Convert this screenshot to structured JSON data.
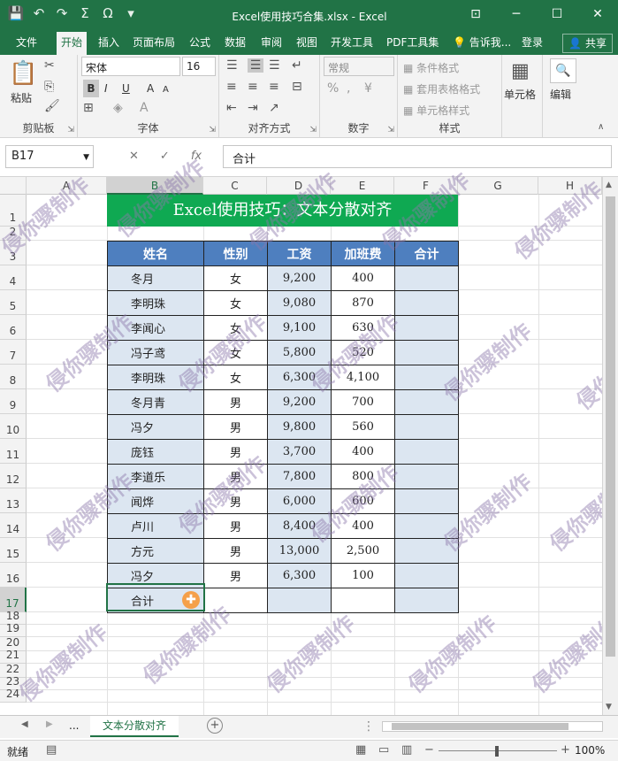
{
  "window": {
    "title": "Excel使用技巧合集.xlsx - Excel"
  },
  "tabs": [
    "文件",
    "开始",
    "插入",
    "页面布局",
    "公式",
    "数据",
    "审阅",
    "视图",
    "开发工具",
    "PDF工具集"
  ],
  "tell_me": "告诉我...",
  "login": "登录",
  "share": "共享",
  "ribbon": {
    "clipboard": {
      "label": "剪贴板",
      "paste": "粘贴"
    },
    "font": {
      "label": "字体",
      "name": "宋体",
      "size": "16",
      "bold": "B",
      "italic": "I",
      "underline": "U",
      "grow": "A",
      "shrink": "A"
    },
    "align": {
      "label": "对齐方式"
    },
    "number": {
      "label": "数字",
      "format": "常规"
    },
    "styles": {
      "label": "样式",
      "cond": "条件格式",
      "table": "套用表格格式",
      "cell": "单元格样式"
    },
    "cells": {
      "label": "单元格"
    },
    "editing": {
      "label": "编辑"
    }
  },
  "formula_bar": {
    "name_box": "B17",
    "fx": "fx",
    "value": "合计",
    "cancel": "✕",
    "enter": "✓"
  },
  "columns": [
    "A",
    "B",
    "C",
    "D",
    "E",
    "F",
    "G",
    "H"
  ],
  "rows": [
    "1",
    "2",
    "3",
    "4",
    "5",
    "6",
    "7",
    "8",
    "9",
    "10",
    "11",
    "12",
    "13",
    "14",
    "15",
    "16",
    "17",
    "18",
    "19",
    "20",
    "21",
    "22",
    "23",
    "24"
  ],
  "sheet": {
    "banner": "Excel使用技巧：文本分散对齐",
    "headers": [
      "姓名",
      "性别",
      "工资",
      "加班费",
      "合计"
    ],
    "records": [
      [
        "冬月",
        "女",
        "9,200",
        "400",
        ""
      ],
      [
        "李明珠",
        "女",
        "9,080",
        "870",
        ""
      ],
      [
        "李闻心",
        "女",
        "9,100",
        "630",
        ""
      ],
      [
        "冯子鸢",
        "女",
        "5,800",
        "520",
        ""
      ],
      [
        "李明珠",
        "女",
        "6,300",
        "4,100",
        ""
      ],
      [
        "冬月青",
        "男",
        "9,200",
        "700",
        ""
      ],
      [
        "冯夕",
        "男",
        "9,800",
        "560",
        ""
      ],
      [
        "庞钰",
        "男",
        "3,700",
        "400",
        ""
      ],
      [
        "李道乐",
        "男",
        "7,800",
        "800",
        ""
      ],
      [
        "闻烨",
        "男",
        "6,000",
        "600",
        ""
      ],
      [
        "卢川",
        "男",
        "8,400",
        "400",
        ""
      ],
      [
        "方元",
        "男",
        "13,000",
        "2,500",
        ""
      ],
      [
        "冯夕",
        "男",
        "6,300",
        "100",
        ""
      ],
      [
        "合计",
        "",
        "",
        "",
        ""
      ]
    ]
  },
  "sheet_tabs": {
    "active": "文本分散对齐",
    "more": "...",
    "add": "+"
  },
  "status": {
    "ready": "就绪",
    "zoom": "100%"
  },
  "watermark": "侵你骤制作",
  "colors": {
    "excel_green": "#217346",
    "banner": "#0fa952",
    "header": "#4e7fbf",
    "band": "#dce6f1"
  }
}
